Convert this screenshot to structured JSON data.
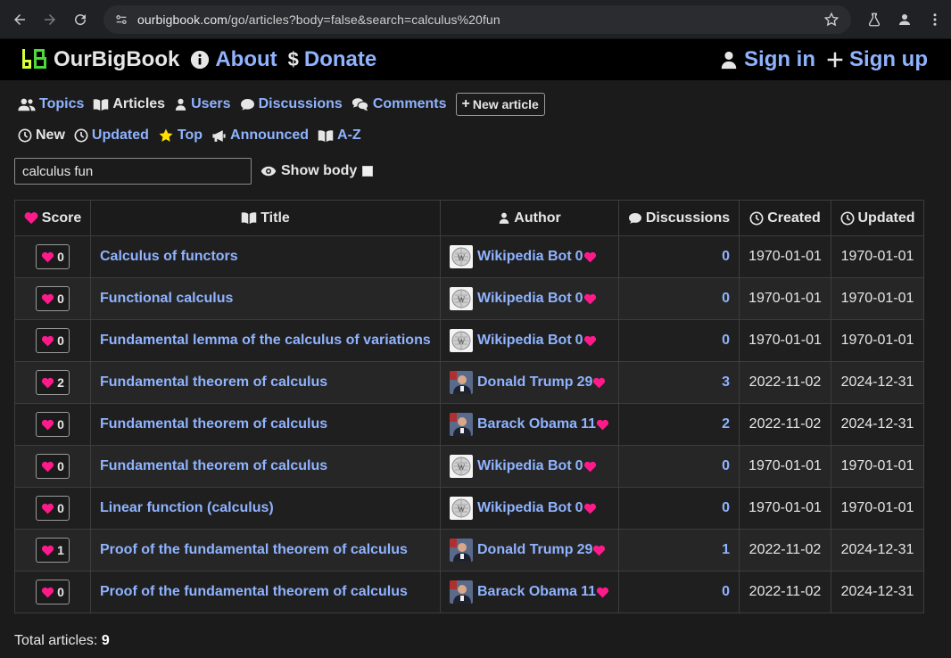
{
  "browser": {
    "url_host": "ourbigbook.com",
    "url_path": "/go/articles?body=false&search=calculus%20fun"
  },
  "navbar": {
    "brand": "OurBigBook",
    "about": "About",
    "donate": "Donate",
    "sign_in": "Sign in",
    "sign_up": "Sign up"
  },
  "tabs": {
    "topics": "Topics",
    "articles": "Articles",
    "users": "Users",
    "discussions": "Discussions",
    "comments": "Comments",
    "new_article": "New article"
  },
  "sort_tabs": {
    "new": "New",
    "updated": "Updated",
    "top": "Top",
    "announced": "Announced",
    "az": "A-Z"
  },
  "search": {
    "value": "calculus fun",
    "show_body": "Show body"
  },
  "table": {
    "headers": {
      "score": "Score",
      "title": "Title",
      "author": "Author",
      "discussions": "Discussions",
      "created": "Created",
      "updated": "Updated"
    },
    "rows": [
      {
        "score": "0",
        "title": "Calculus of functors",
        "author": "Wikipedia Bot",
        "author_score": "0",
        "avatar": "wikipedia",
        "discussions": "0",
        "created": "1970-01-01",
        "updated": "1970-01-01"
      },
      {
        "score": "0",
        "title": "Functional calculus",
        "author": "Wikipedia Bot",
        "author_score": "0",
        "avatar": "wikipedia",
        "discussions": "0",
        "created": "1970-01-01",
        "updated": "1970-01-01"
      },
      {
        "score": "0",
        "title": "Fundamental lemma of the calculus of variations",
        "author": "Wikipedia Bot",
        "author_score": "0",
        "avatar": "wikipedia",
        "discussions": "0",
        "created": "1970-01-01",
        "updated": "1970-01-01"
      },
      {
        "score": "2",
        "title": "Fundamental theorem of calculus",
        "author": "Donald Trump",
        "author_score": "29",
        "avatar": "person",
        "discussions": "3",
        "created": "2022-11-02",
        "updated": "2024-12-31"
      },
      {
        "score": "0",
        "title": "Fundamental theorem of calculus",
        "author": "Barack Obama",
        "author_score": "11",
        "avatar": "person",
        "discussions": "2",
        "created": "2022-11-02",
        "updated": "2024-12-31"
      },
      {
        "score": "0",
        "title": "Fundamental theorem of calculus",
        "author": "Wikipedia Bot",
        "author_score": "0",
        "avatar": "wikipedia",
        "discussions": "0",
        "created": "1970-01-01",
        "updated": "1970-01-01"
      },
      {
        "score": "0",
        "title": "Linear function (calculus)",
        "author": "Wikipedia Bot",
        "author_score": "0",
        "avatar": "wikipedia",
        "discussions": "0",
        "created": "1970-01-01",
        "updated": "1970-01-01"
      },
      {
        "score": "1",
        "title": "Proof of the fundamental theorem of calculus",
        "author": "Donald Trump",
        "author_score": "29",
        "avatar": "person",
        "discussions": "1",
        "created": "2022-11-02",
        "updated": "2024-12-31"
      },
      {
        "score": "0",
        "title": "Proof of the fundamental theorem of calculus",
        "author": "Barack Obama",
        "author_score": "11",
        "avatar": "person",
        "discussions": "0",
        "created": "2022-11-02",
        "updated": "2024-12-31"
      }
    ]
  },
  "footer": {
    "total_label": "Total articles:",
    "total_value": "9"
  },
  "colors": {
    "link": "#8fb3ff",
    "heart": "#ff1a8c",
    "background": "#1b1b1b",
    "navbar": "#000000"
  }
}
